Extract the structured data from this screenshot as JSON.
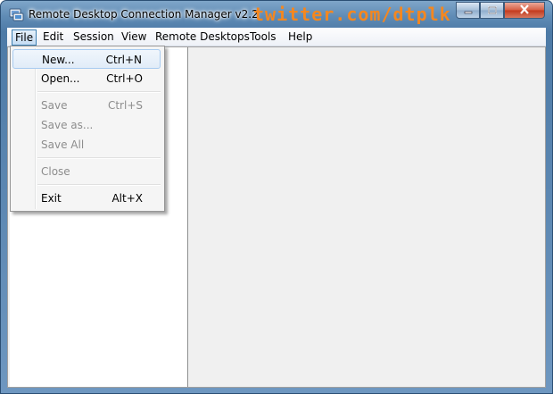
{
  "window": {
    "title": "Remote Desktop Connection Manager v2.2",
    "watermark": "twitter.com/dtplk"
  },
  "menubar": {
    "items": [
      "File",
      "Edit",
      "Session",
      "View",
      "Remote Desktops",
      "Tools",
      "Help"
    ]
  },
  "file_menu": {
    "items": [
      {
        "label": "New...",
        "shortcut": "Ctrl+N"
      },
      {
        "label": "Open...",
        "shortcut": "Ctrl+O"
      },
      {
        "label": "Save",
        "shortcut": "Ctrl+S"
      },
      {
        "label": "Save as...",
        "shortcut": ""
      },
      {
        "label": "Save All",
        "shortcut": ""
      },
      {
        "label": "Close",
        "shortcut": ""
      },
      {
        "label": "Exit",
        "shortcut": "Alt+X"
      }
    ]
  },
  "colors": {
    "watermark": "#f5871f",
    "highlight": "#a8cbf0"
  },
  "icons": [
    "app-icon",
    "minimize-icon",
    "maximize-icon",
    "close-icon"
  ]
}
